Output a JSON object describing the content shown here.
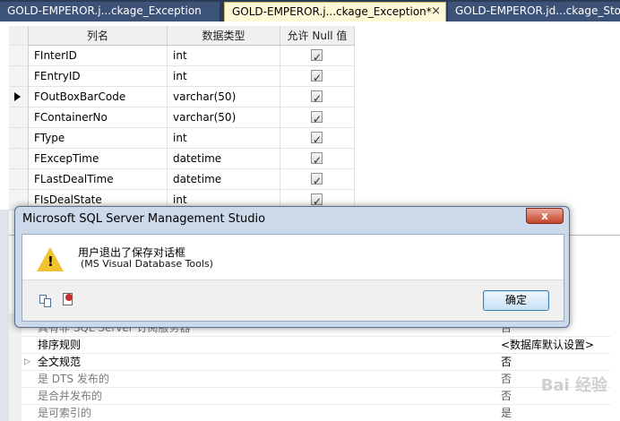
{
  "tabs": [
    {
      "label": "GOLD-EMPEROR.j...ckage_Exception"
    },
    {
      "label": "GOLD-EMPEROR.j...ckage_Exception*",
      "active": true,
      "close": "×"
    },
    {
      "label": "GOLD-EMPEROR.jd...ckage_Stock"
    }
  ],
  "grid": {
    "headers": [
      "列名",
      "数据类型",
      "允许 Null 值"
    ],
    "rows": [
      {
        "name": "FInterID",
        "type": "int",
        "allow_null": true
      },
      {
        "name": "FEntryID",
        "type": "int",
        "allow_null": true
      },
      {
        "name": "FOutBoxBarCode",
        "type": "varchar(50)",
        "allow_null": true,
        "current": true
      },
      {
        "name": "FContainerNo",
        "type": "varchar(50)",
        "allow_null": true
      },
      {
        "name": "FType",
        "type": "int",
        "allow_null": true
      },
      {
        "name": "FExcepTime",
        "type": "datetime",
        "allow_null": true
      },
      {
        "name": "FLastDealTime",
        "type": "datetime",
        "allow_null": true
      },
      {
        "name": "FIsDealState",
        "type": "int",
        "allow_null": true
      }
    ]
  },
  "dialog": {
    "title": "Microsoft SQL Server Management Studio",
    "close_label": "x",
    "message": "用户退出了保存对话框",
    "source": "(MS Visual Database Tools)",
    "ok_label": "确定",
    "icon": "warning-icon"
  },
  "properties": {
    "rows": [
      {
        "name": "具有非 SQL Server 订阅服务器",
        "value": "否",
        "dim": true
      },
      {
        "name": "排序规则",
        "value": "<数据库默认设置>",
        "dim": false
      },
      {
        "name": "全文规范",
        "value": "否",
        "dim": false,
        "expandable": true
      },
      {
        "name": "是 DTS 发布的",
        "value": "否",
        "dim": true
      },
      {
        "name": "是合并发布的",
        "value": "否",
        "dim": true
      },
      {
        "name": "是可索引的",
        "value": "是",
        "dim": true
      }
    ]
  },
  "watermark": "Bai 经验"
}
